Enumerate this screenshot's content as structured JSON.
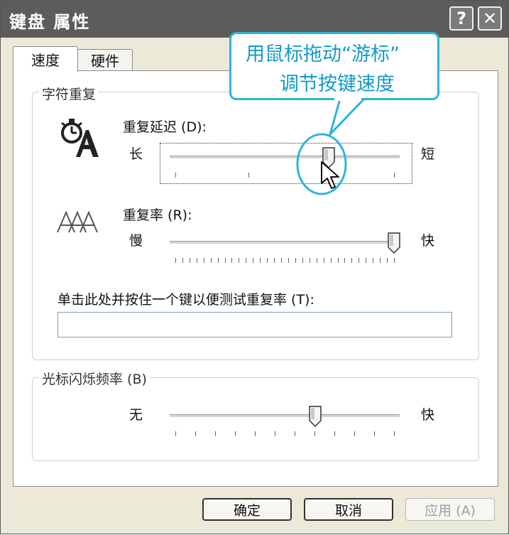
{
  "window": {
    "title": "键盘 属性",
    "help_glyph": "?",
    "close_glyph": "✕"
  },
  "tabs": [
    {
      "label": "速度",
      "active": true
    },
    {
      "label": "硬件",
      "active": false
    }
  ],
  "char_repeat": {
    "legend": "字符重复",
    "delay": {
      "label": "重复延迟 (D):",
      "left_label": "长",
      "right_label": "短",
      "value_fraction": 0.7,
      "ticks": 4
    },
    "rate": {
      "label": "重复率 (R):",
      "left_label": "慢",
      "right_label": "快",
      "value_fraction": 1.0,
      "ticks": 32
    },
    "test_label": "单击此处并按住一个键以便测试重复率 (T):",
    "test_value": ""
  },
  "cursor_blink": {
    "legend": "光标闪烁频率 (B)",
    "left_label": "无",
    "right_label": "快",
    "value_fraction": 0.64,
    "ticks": 12
  },
  "buttons": {
    "ok": "确定",
    "cancel": "取消",
    "apply": "应用 (A)"
  },
  "callout": {
    "line1": "用鼠标拖动“游标”",
    "line2": "调节按键速度"
  },
  "colors": {
    "callout_accent": "#2fb3da",
    "callout_text": "#1599c8",
    "titlebar": "#5c5c5c"
  },
  "icons": {
    "delay_icon": "stopwatch-letter-a-icon",
    "rate_icon": "triple-a-icon",
    "cursor": "mouse-pointer-icon"
  }
}
